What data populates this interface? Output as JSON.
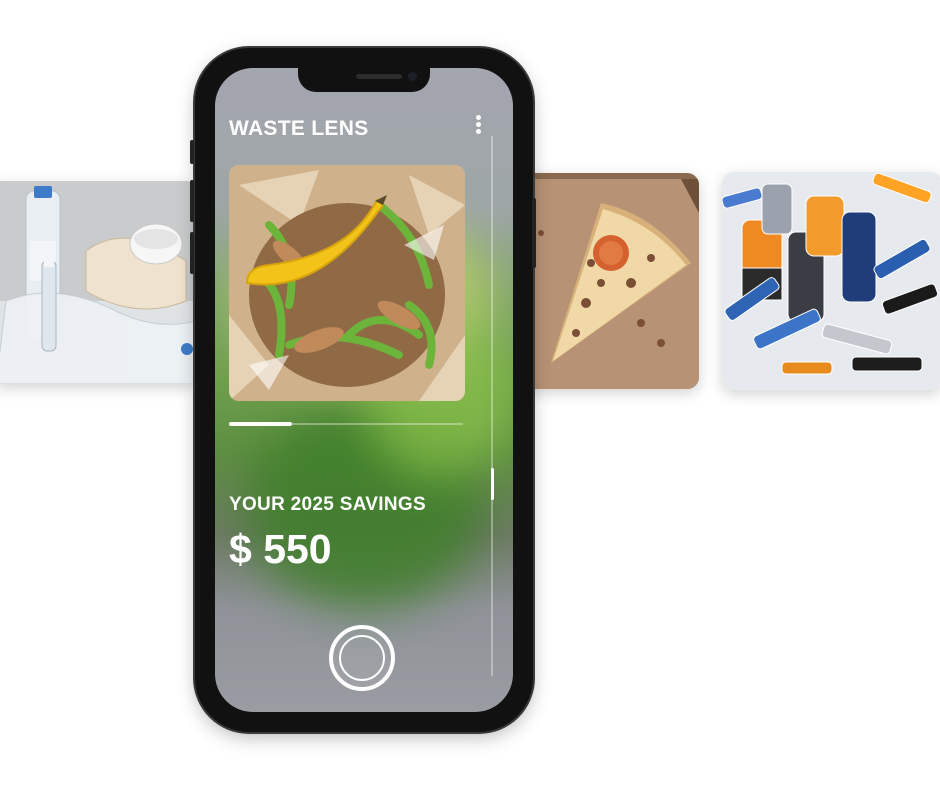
{
  "app": {
    "title": "WASTE LENS",
    "menu_icon": "more-vertical-icon",
    "savings_label": "YOUR 2025 SAVINGS",
    "savings_value": "$ 550",
    "carousel_progress": 0.27,
    "shutter_icon": "camera-shutter-icon"
  },
  "gallery": [
    {
      "name": "plastic-bottles-photo",
      "subject": "plastic waste"
    },
    {
      "name": "pizza-slice-photo",
      "subject": "pizza leftovers"
    },
    {
      "name": "batteries-photo",
      "subject": "used batteries"
    }
  ],
  "colors": {
    "accent": "#ffffff",
    "phone_frame": "#111111",
    "banana": "#f2c318",
    "peel_green": "#6cb43a"
  }
}
